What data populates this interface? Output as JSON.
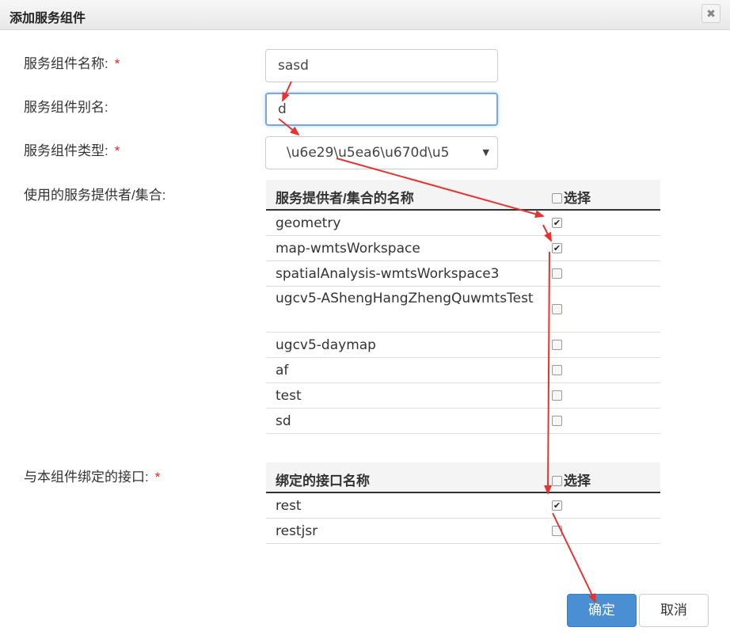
{
  "dialog": {
    "title": "添加服务组件",
    "close_symbol": "✖"
  },
  "form": {
    "name_label": "服务组件名称:",
    "name_value": "sasd",
    "alias_label": "服务组件别名:",
    "alias_value": "d",
    "type_label": "服务组件类型:",
    "type_value": "\\u6e29\\u5ea6\\u670d\\u5",
    "providers_label": "使用的服务提供者/集合:",
    "interfaces_label": "与本组件绑定的接口:",
    "required_mark": "*"
  },
  "providers_table": {
    "header_name": "服务提供者/集合的名称",
    "header_select": "选择",
    "rows": [
      {
        "name": "geometry",
        "checked": true
      },
      {
        "name": "map-wmtsWorkspace",
        "checked": true
      },
      {
        "name": "spatialAnalysis-wmtsWorkspace3",
        "checked": false
      },
      {
        "name": "ugcv5-AShengHangZhengQuwmtsTest",
        "checked": false
      },
      {
        "name": "ugcv5-daymap",
        "checked": false
      },
      {
        "name": "af",
        "checked": false
      },
      {
        "name": "test",
        "checked": false
      },
      {
        "name": "sd",
        "checked": false
      }
    ]
  },
  "interfaces_table": {
    "header_name": "绑定的接口名称",
    "header_select": "选择",
    "rows": [
      {
        "name": "rest",
        "checked": true
      },
      {
        "name": "restjsr",
        "checked": false
      }
    ]
  },
  "buttons": {
    "ok": "确定",
    "cancel": "取消"
  },
  "colors": {
    "annotation_arrow": "#e8322f",
    "primary_button": "#4a8fd4",
    "required": "#e02020"
  },
  "check_glyph": "✔"
}
